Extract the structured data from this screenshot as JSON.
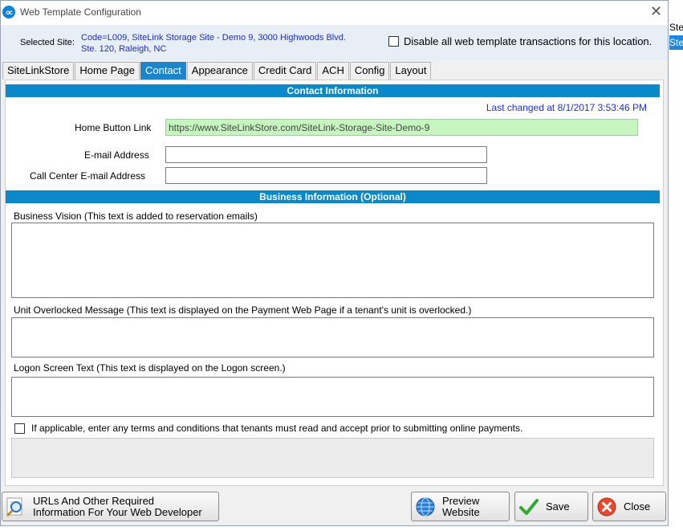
{
  "window": {
    "title": "Web Template Configuration",
    "app_icon_text": "oc"
  },
  "site": {
    "label": "Selected  Site:",
    "value_line1": "Code=L009,   SiteLink Storage Site - Demo 9, 3000 Highwoods Blvd.",
    "value_line2": "Ste. 120, Raleigh, NC",
    "disable_label": "Disable all web template transactions for this location.",
    "disable_checked": false
  },
  "tabs": [
    {
      "label": "SiteLinkStore",
      "active": false
    },
    {
      "label": "Home Page",
      "active": false
    },
    {
      "label": "Contact",
      "active": true
    },
    {
      "label": "Appearance",
      "active": false
    },
    {
      "label": "Credit Card",
      "active": false
    },
    {
      "label": "ACH",
      "active": false
    },
    {
      "label": "Config",
      "active": false
    },
    {
      "label": "Layout",
      "active": false
    }
  ],
  "contact": {
    "header": "Contact Information",
    "last_changed": "Last changed at 8/1/2017 3:53:46 PM",
    "home_button_label": "Home Button Link",
    "home_button_value": "https://www.SiteLinkStore.com/SiteLink-Storage-Site-Demo-9",
    "email_label": "E-mail Address",
    "email_value": "",
    "call_center_label": "Call Center E-mail Address",
    "call_center_value": ""
  },
  "business": {
    "header": "Business Information (Optional)",
    "vision_label": "Business Vision  (This text is added to reservation emails)",
    "overlocked_label": "Unit Overlocked Message (This text is displayed on the Payment Web Page if a tenant's unit is overlocked.)",
    "logon_label": "Logon Screen Text (This text is displayed on the Logon screen.)",
    "terms_label": "If applicable, enter any terms and conditions that tenants must read and accept prior to submitting online payments.",
    "terms_checked": false
  },
  "buttons": {
    "urls_line1": "URLs And Other Required",
    "urls_line2": "Information For Your Web Developer",
    "preview_line1": "Preview",
    "preview_line2": "Website",
    "save": "Save",
    "close": "Close"
  },
  "background_fragments": {
    "top": "Ste",
    "selected": "Ste"
  },
  "colors": {
    "accent": "#0a88c8",
    "active_tab": "#1e86c8",
    "link_blue": "#1e2fd8",
    "green_field": "#c6f5c0"
  }
}
